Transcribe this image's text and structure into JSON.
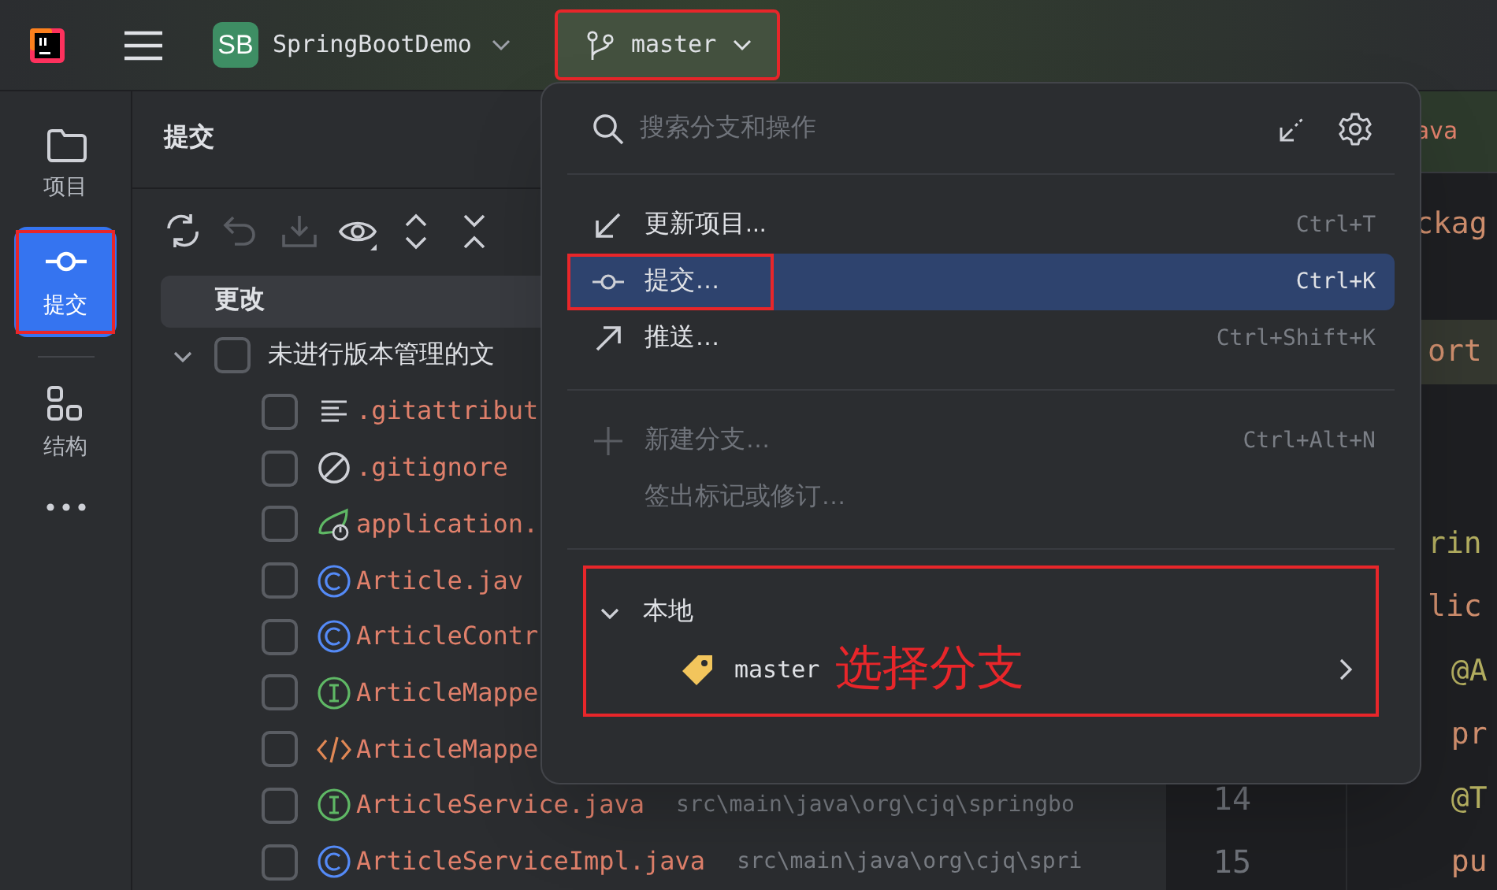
{
  "top_bar": {
    "project": {
      "badge": "SB",
      "name": "SpringBootDemo"
    },
    "branch": {
      "name": "master",
      "annotated": true
    }
  },
  "tool_window_bar": [
    {
      "kind": "folder",
      "label": "项目",
      "selected": false,
      "annotated": false
    },
    {
      "kind": "commit",
      "label": "提交",
      "selected": true,
      "annotated": true
    },
    {
      "kind": "structure",
      "label": "结构",
      "selected": false,
      "annotated": false
    }
  ],
  "commit_panel": {
    "title": "提交",
    "toolbar": [
      {
        "kind": "refresh",
        "disabled": false
      },
      {
        "kind": "rollback",
        "disabled": true
      },
      {
        "kind": "shelve",
        "disabled": true
      },
      {
        "kind": "view",
        "disabled": false
      },
      {
        "kind": "expand",
        "disabled": false
      },
      {
        "kind": "collapse",
        "disabled": false
      }
    ],
    "changes_header": "更改",
    "group": {
      "label": "未进行版本管理的文",
      "expanded": true,
      "checked": false,
      "children": [
        {
          "kind": "text",
          "name": ".gitattribut",
          "checked": false
        },
        {
          "kind": "ignore",
          "name": ".gitignore",
          "checked": false
        },
        {
          "kind": "spring",
          "name": "application.",
          "checked": false
        },
        {
          "kind": "class",
          "name": "Article.jav",
          "checked": false
        },
        {
          "kind": "class",
          "name": "ArticleContr",
          "checked": false
        },
        {
          "kind": "interface",
          "name": "ArticleMappe",
          "checked": false
        },
        {
          "kind": "xml",
          "name": "ArticleMappe",
          "checked": false
        },
        {
          "kind": "interface",
          "name": "ArticleService.java",
          "path": "src\\main\\java\\org\\cjq\\springbo",
          "checked": false
        },
        {
          "kind": "class",
          "name": "ArticleServiceImpl.java",
          "path": "src\\main\\java\\org\\cjq\\spri",
          "checked": false
        }
      ]
    }
  },
  "editor": {
    "tab": "ava",
    "lines": [
      {
        "kind": "keyword",
        "text": "ckag",
        "highlighted": false
      },
      {
        "highlighted": false
      },
      {
        "kind": "keyword",
        "text": "ort",
        "highlighted": true
      },
      {
        "highlighted": false
      },
      {
        "highlighted": false
      },
      {
        "kind": "annotation",
        "text": "rin",
        "highlighted": false
      },
      {
        "kind": "keyword",
        "text": "lic",
        "highlighted": false
      },
      {
        "kind": "annotation",
        "text": "  @A",
        "highlighted": false
      },
      {
        "kind": "keyword",
        "text": "  pr",
        "highlighted": false
      },
      {
        "kind": "annotation",
        "text": "  @T",
        "number": "14",
        "highlighted": false
      },
      {
        "kind": "keyword",
        "text": "  pu",
        "number": "15",
        "highlighted": false
      }
    ]
  },
  "branch_popup": {
    "search_placeholder": "搜索分支和操作",
    "action_groups": [
      [
        {
          "kind": "update",
          "label": "更新项目...",
          "shortcut": "Ctrl+T",
          "selected": false,
          "disabled": false,
          "annotated": false
        },
        {
          "kind": "commit",
          "label": "提交…",
          "shortcut": "Ctrl+K",
          "selected": true,
          "disabled": false,
          "annotated": true
        },
        {
          "kind": "push",
          "label": "推送…",
          "shortcut": "Ctrl+Shift+K",
          "selected": false,
          "disabled": false,
          "annotated": false
        }
      ],
      [
        {
          "kind": "new",
          "label": "新建分支…",
          "shortcut": "Ctrl+Alt+N",
          "selected": false,
          "disabled": true,
          "annotated": false
        },
        {
          "kind": "none",
          "label": "签出标记或修订…",
          "selected": false,
          "disabled": true,
          "annotated": false
        }
      ]
    ],
    "local": {
      "label": "本地",
      "expanded": true,
      "annotated": true,
      "branches": [
        {
          "name": "master",
          "note": "选择分支"
        }
      ]
    }
  }
}
